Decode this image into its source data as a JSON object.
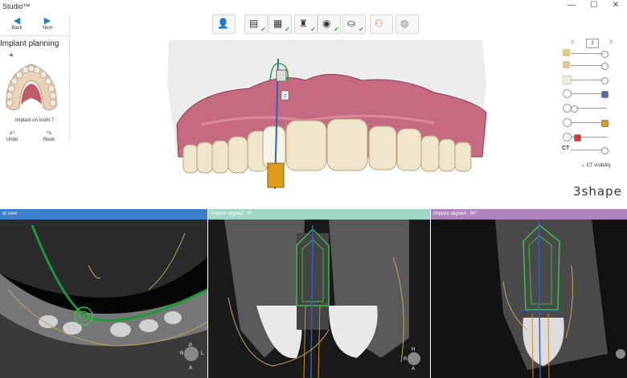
{
  "window": {
    "title": "Studio™",
    "min": "—",
    "max": "☐",
    "close": "✕"
  },
  "nav": {
    "back": "Back",
    "next": "Next"
  },
  "left_panel": {
    "title": "Implant planning",
    "caption": "Implant on tooth 7",
    "undo": "Undo",
    "redo": "Redo"
  },
  "toolbar": {
    "icons": [
      "patient-icon",
      "scan-check-icon",
      "scan-check-icon",
      "implant-check-icon",
      "jaw-check-icon",
      "tooth-check-icon",
      "people-icon",
      "globe-icon"
    ]
  },
  "viewport": {
    "tooth_label": "7"
  },
  "right_panel": {
    "steps": [
      "1",
      "2",
      "3"
    ],
    "active_step": "2",
    "ct_visibility": "CT visibility",
    "ct_label": "CT"
  },
  "brand": "3shape",
  "panels": [
    {
      "title": "al view",
      "header_color": "#3a7fc8"
    },
    {
      "title": "Implant aligned : 0°",
      "header_color": "#9fd6c6"
    },
    {
      "title": "Implant aligned : 90°",
      "header_color": "#b083bd"
    }
  ],
  "orientation": {
    "p1": [
      "P",
      "R",
      "L",
      "A"
    ],
    "p2": [
      "H",
      "R",
      "A"
    ]
  }
}
